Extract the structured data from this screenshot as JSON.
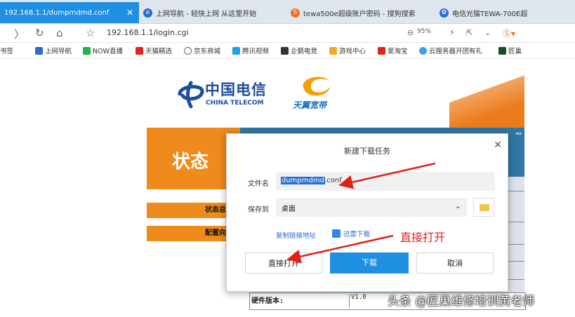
{
  "tabs": [
    {
      "label": "192.168.1.1/dumpmdmd.conf",
      "active": true
    },
    {
      "label": "上网导航 - 轻快上网 从这里开始"
    },
    {
      "label": "tewa500e超级账户密码 - 搜狗搜索"
    },
    {
      "label": "电信光猫TEWA-700E超"
    }
  ],
  "address": {
    "url": "192.168.1.1/login.cgi",
    "zoom": "95%"
  },
  "bookmarks": [
    {
      "label": "书签"
    },
    {
      "label": "上网导航"
    },
    {
      "label": "NOW直播"
    },
    {
      "label": "天猫精选"
    },
    {
      "label": "京东商城"
    },
    {
      "label": "腾讯视频"
    },
    {
      "label": "企鹅电竞"
    },
    {
      "label": "游戏中心"
    },
    {
      "label": "爱淘宝"
    },
    {
      "label": "云服务器开团有礼"
    },
    {
      "label": "匠巢"
    }
  ],
  "page": {
    "brand_cn": "中国电信",
    "brand_en": "CHINA TELECOM",
    "brand2": "天翼宽带",
    "section_title": "状态",
    "side_items": [
      "状态总",
      "配置向"
    ],
    "right_top": "相关",
    "hw_label": "硬件版本:",
    "hw_value": "V1.0"
  },
  "dialog": {
    "title": "新建下载任务",
    "filename_label": "文件名",
    "filename_selected": "dumpmdmd",
    "filename_ext": ".conf",
    "saveto_label": "保存到",
    "saveto_value": "桌面",
    "copy_link": "复制链接地址",
    "xunlei": "迅雷下载",
    "btn_open": "直接打开",
    "btn_download": "下载",
    "btn_cancel": "取消"
  },
  "annotation": "直接打开",
  "watermark": "头条 @匠巢维修培训黄老师",
  "colors": {
    "orange": "#ef8a1c",
    "blue": "#1e8fe1",
    "red_annotation": "#e0201a"
  }
}
